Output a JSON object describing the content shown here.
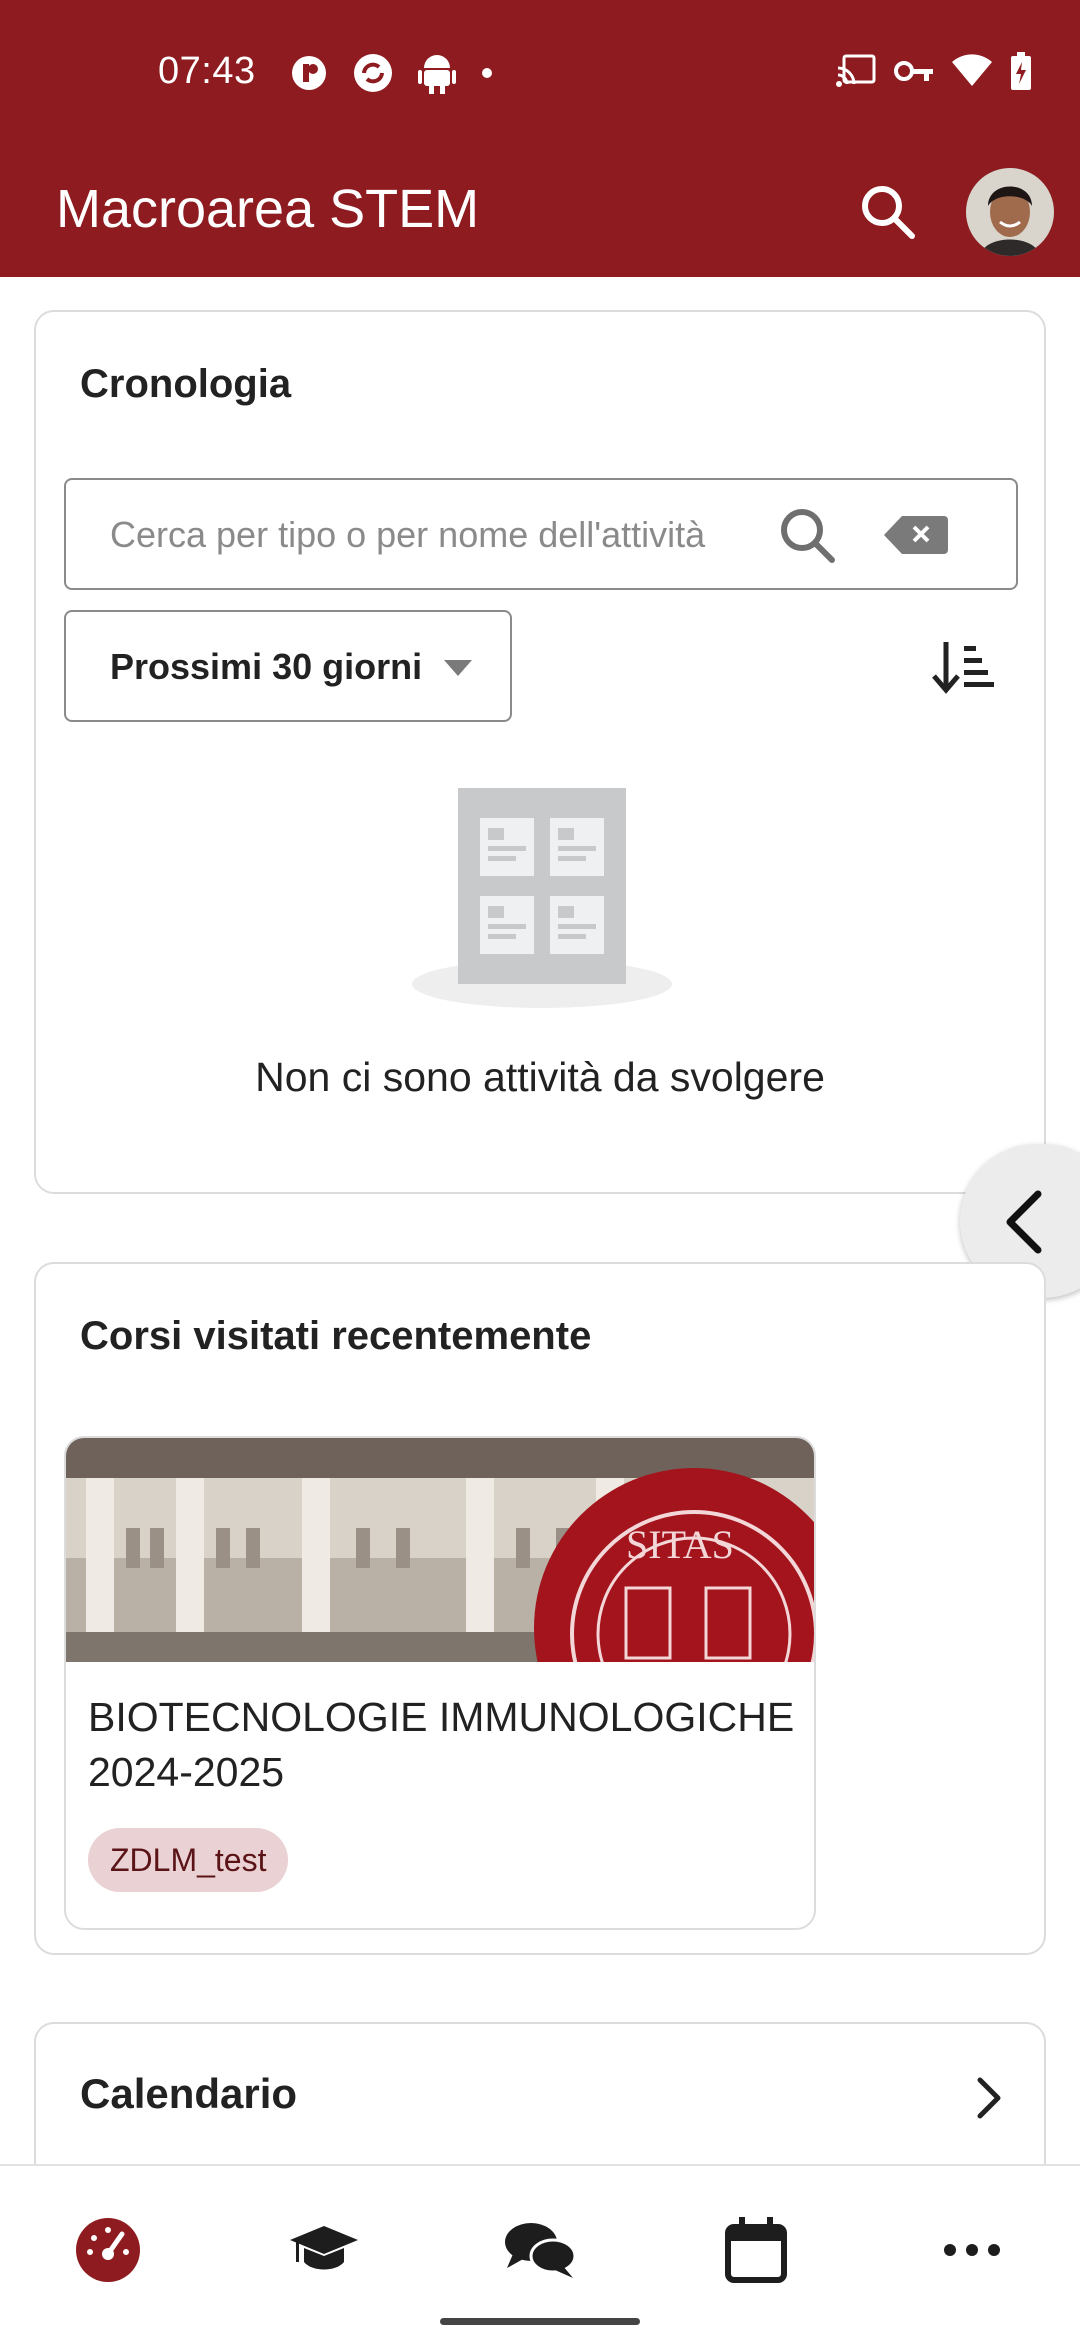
{
  "status_bar": {
    "time": "07:43"
  },
  "app_bar": {
    "title": "Macroarea STEM"
  },
  "timeline": {
    "title": "Cronologia",
    "search_placeholder": "Cerca per tipo o per nome dell'attività",
    "filter_label": "Prossimi 30 giorni",
    "empty_message": "Non ci sono attività da svolgere"
  },
  "recent_courses": {
    "title": "Corsi visitati recentemente",
    "courses": [
      {
        "name": "BIOTECNOLOGIE IMMUNOLOGICHE 2024-2025",
        "tag": "ZDLM_test"
      }
    ]
  },
  "calendar": {
    "title": "Calendario"
  },
  "bottom_nav": {
    "items": [
      "dashboard-icon",
      "courses-icon",
      "messages-icon",
      "calendar-icon",
      "more-icon"
    ]
  },
  "colors": {
    "brand": "#8e1b1f",
    "tag_bg": "#ead1d3"
  }
}
